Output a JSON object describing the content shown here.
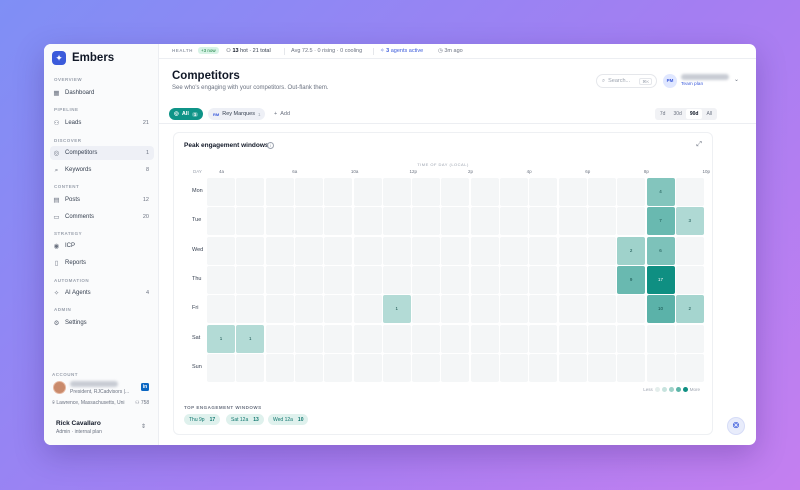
{
  "app": {
    "name": "Embers"
  },
  "sidebar": {
    "sections": {
      "overview": "OVERVIEW",
      "pipeline": "PIPELINE",
      "discover": "DISCOVER",
      "content": "CONTENT",
      "strategy": "STRATEGY",
      "automation": "AUTOMATION",
      "admin": "ADMIN"
    },
    "items": [
      {
        "label": "Dashboard",
        "icon": "dashboard-icon",
        "count": ""
      },
      {
        "label": "Leads",
        "icon": "leads-icon",
        "count": "21"
      },
      {
        "label": "Competitors",
        "icon": "competitors-icon",
        "count": "1"
      },
      {
        "label": "Keywords",
        "icon": "keywords-icon",
        "count": "8"
      },
      {
        "label": "Posts",
        "icon": "posts-icon",
        "count": "12"
      },
      {
        "label": "Comments",
        "icon": "comments-icon",
        "count": "20"
      },
      {
        "label": "ICP",
        "icon": "icp-icon",
        "count": ""
      },
      {
        "label": "Reports",
        "icon": "reports-icon",
        "count": ""
      },
      {
        "label": "AI Agents",
        "icon": "ai-agents-icon",
        "count": "4"
      },
      {
        "label": "Settings",
        "icon": "settings-icon",
        "count": ""
      }
    ],
    "account": {
      "label": "ACCOUNT",
      "title": "President, RJCadvisors |...",
      "location": "Lawrence, Massachusetts, Uni",
      "connections": "758"
    },
    "user": {
      "name": "Rick Cavallaro",
      "role": "Admin · internal plan"
    }
  },
  "statusbar": {
    "health_label": "HEALTH",
    "health_badge": "+3 now",
    "hot_count": "13",
    "hot_text": "hot · 21 total",
    "avg_text": "Avg 72.5 · 0 rising · 0 cooling",
    "agents_count": "3",
    "agents_text": "agents active",
    "time_text": "3m ago"
  },
  "header": {
    "title": "Competitors",
    "subtitle": "See who's engaging with your competitors. Out-flank them.",
    "search_placeholder": "Search...",
    "search_kbd": "⌘K",
    "team_initials": "PM",
    "team_plan": "Team plan"
  },
  "filters": {
    "all_label": "All",
    "all_count": "1",
    "person_initials": "RM",
    "person_label": "Rey Marques",
    "person_count": "1",
    "add_label": "Add",
    "ranges": [
      "7d",
      "30d",
      "90d",
      "All"
    ],
    "active_range": "90d"
  },
  "heatmap": {
    "title": "Peak engagement windows",
    "axis_title": "TIME OF DAY (LOCAL)",
    "day_header": "DAY",
    "hour_labels": [
      "4a",
      "6a",
      "10a",
      "12p",
      "2p",
      "4p",
      "6p",
      "8p",
      "10p"
    ],
    "days": [
      "Mon",
      "Tue",
      "Wed",
      "Thu",
      "Fri",
      "Sat",
      "Sun"
    ],
    "columns": 17,
    "cells": [
      {
        "day": 0,
        "col": 15,
        "value": "4",
        "level": 0.42
      },
      {
        "day": 1,
        "col": 15,
        "value": "7",
        "level": 0.55
      },
      {
        "day": 1,
        "col": 16,
        "value": "3",
        "level": 0.2
      },
      {
        "day": 2,
        "col": 14,
        "value": "2",
        "level": 0.28
      },
      {
        "day": 2,
        "col": 15,
        "value": "6",
        "level": 0.45
      },
      {
        "day": 3,
        "col": 14,
        "value": "9",
        "level": 0.55
      },
      {
        "day": 3,
        "col": 15,
        "value": "17",
        "level": 1.0
      },
      {
        "day": 4,
        "col": 6,
        "value": "1",
        "level": 0.18
      },
      {
        "day": 4,
        "col": 15,
        "value": "10",
        "level": 0.62
      },
      {
        "day": 4,
        "col": 16,
        "value": "2",
        "level": 0.25
      },
      {
        "day": 5,
        "col": 0,
        "value": "1",
        "level": 0.18
      },
      {
        "day": 5,
        "col": 1,
        "value": "1",
        "level": 0.18
      }
    ],
    "legend_less": "Less",
    "legend_more": "More",
    "legend_colors": [
      "#e4eeec",
      "#c7e3de",
      "#9fd2c9",
      "#5cb5a8",
      "#0f8f82"
    ],
    "top_label": "TOP ENGAGEMENT WINDOWS",
    "top_windows": [
      {
        "label": "Thu 9p",
        "value": "17"
      },
      {
        "label": "Sat 12a",
        "value": "13"
      },
      {
        "label": "Wed 12a",
        "value": "10"
      }
    ]
  }
}
